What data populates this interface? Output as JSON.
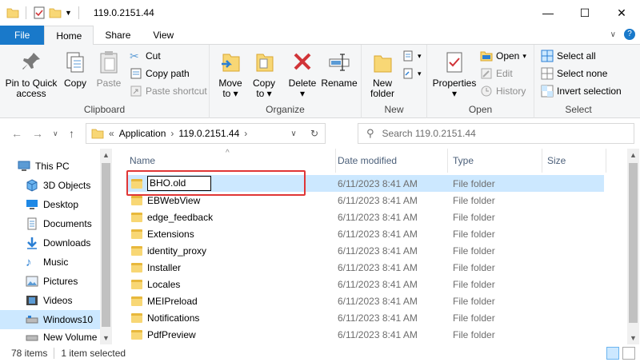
{
  "window": {
    "title": "119.0.2151.44"
  },
  "window_buttons": {
    "minimize": "—",
    "maximize": "☐",
    "close": "✕"
  },
  "tabs": [
    {
      "label": "File"
    },
    {
      "label": "Home"
    },
    {
      "label": "Share"
    },
    {
      "label": "View"
    }
  ],
  "ribbon": {
    "clipboard": {
      "label": "Clipboard",
      "pin": "Pin to Quick access",
      "copy": "Copy",
      "paste": "Paste",
      "cut": "Cut",
      "copy_path": "Copy path",
      "paste_shortcut": "Paste shortcut"
    },
    "organize": {
      "label": "Organize",
      "move_to": "Move to",
      "copy_to": "Copy to",
      "delete": "Delete",
      "rename": "Rename"
    },
    "new": {
      "label": "New",
      "new_folder": "New folder"
    },
    "open": {
      "label": "Open",
      "properties": "Properties",
      "open": "Open",
      "edit": "Edit",
      "history": "History"
    },
    "select": {
      "label": "Select",
      "select_all": "Select all",
      "select_none": "Select none",
      "invert": "Invert selection"
    }
  },
  "address": {
    "prefix": "«",
    "crumbs": [
      "Application",
      "119.0.2151.44"
    ],
    "search_placeholder": "Search 119.0.2151.44"
  },
  "nav": [
    {
      "label": "This PC",
      "icon": "pc-icon"
    },
    {
      "label": "3D Objects",
      "icon": "cube-icon"
    },
    {
      "label": "Desktop",
      "icon": "desktop-icon"
    },
    {
      "label": "Documents",
      "icon": "documents-icon"
    },
    {
      "label": "Downloads",
      "icon": "download-icon"
    },
    {
      "label": "Music",
      "icon": "music-icon"
    },
    {
      "label": "Pictures",
      "icon": "pictures-icon"
    },
    {
      "label": "Videos",
      "icon": "videos-icon"
    },
    {
      "label": "Windows10",
      "icon": "drive-icon"
    },
    {
      "label": "New Volume",
      "icon": "drive-icon"
    }
  ],
  "columns": {
    "name": "Name",
    "date": "Date modified",
    "type": "Type",
    "size": "Size"
  },
  "files": [
    {
      "name": "BHO.old",
      "date": "6/11/2023 8:41 AM",
      "type": "File folder"
    },
    {
      "name": "EBWebView",
      "date": "6/11/2023 8:41 AM",
      "type": "File folder"
    },
    {
      "name": "edge_feedback",
      "date": "6/11/2023 8:41 AM",
      "type": "File folder"
    },
    {
      "name": "Extensions",
      "date": "6/11/2023 8:41 AM",
      "type": "File folder"
    },
    {
      "name": "identity_proxy",
      "date": "6/11/2023 8:41 AM",
      "type": "File folder"
    },
    {
      "name": "Installer",
      "date": "6/11/2023 8:41 AM",
      "type": "File folder"
    },
    {
      "name": "Locales",
      "date": "6/11/2023 8:41 AM",
      "type": "File folder"
    },
    {
      "name": "MEIPreload",
      "date": "6/11/2023 8:41 AM",
      "type": "File folder"
    },
    {
      "name": "Notifications",
      "date": "6/11/2023 8:41 AM",
      "type": "File folder"
    },
    {
      "name": "PdfPreview",
      "date": "6/11/2023 8:41 AM",
      "type": "File folder"
    }
  ],
  "status": {
    "count": "78 items",
    "selected": "1 item selected"
  },
  "colors": {
    "file_tab": "#1979ca",
    "selection": "#cce8ff",
    "highlight": "#e03636"
  }
}
